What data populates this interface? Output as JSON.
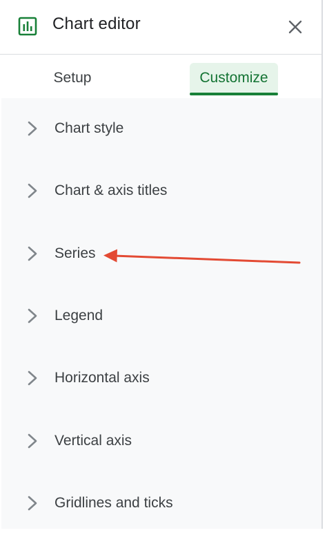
{
  "header": {
    "title": "Chart editor",
    "icon": "chart-icon",
    "close_icon": "close-icon"
  },
  "tabs": [
    {
      "label": "Setup",
      "active": false
    },
    {
      "label": "Customize",
      "active": true
    }
  ],
  "sections": [
    {
      "label": "Chart style"
    },
    {
      "label": "Chart & axis titles"
    },
    {
      "label": "Series"
    },
    {
      "label": "Legend"
    },
    {
      "label": "Horizontal axis"
    },
    {
      "label": "Vertical axis"
    },
    {
      "label": "Gridlines and ticks"
    }
  ],
  "annotation": {
    "points_to": "Series",
    "color": "#e34a33"
  },
  "colors": {
    "accent_green": "#188038",
    "active_tab_bg": "#e6f4ea",
    "list_bg": "#f8f9fa"
  }
}
